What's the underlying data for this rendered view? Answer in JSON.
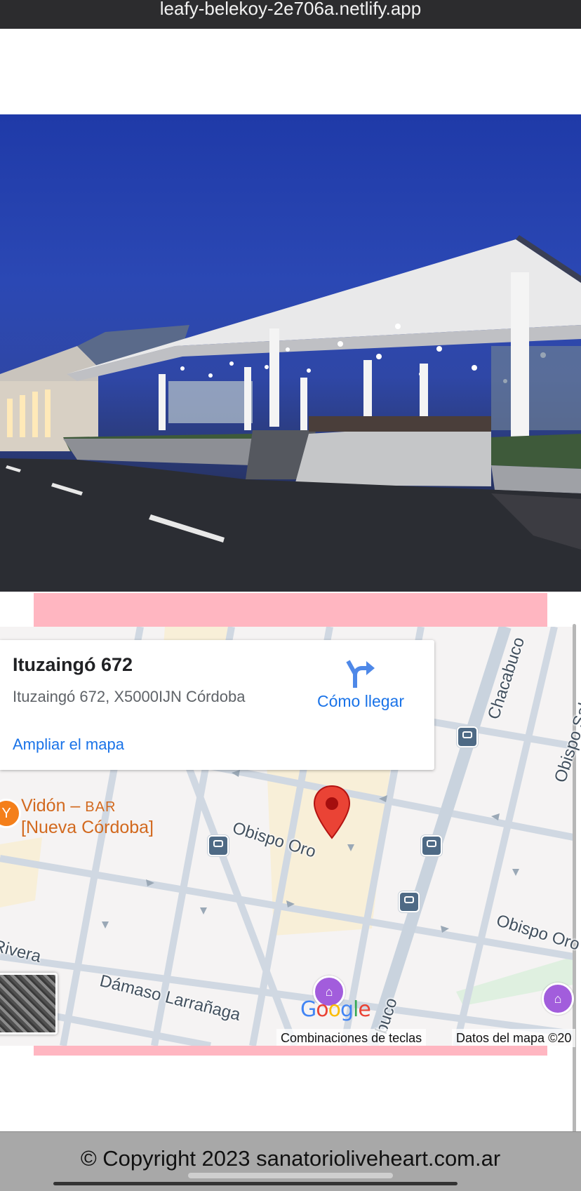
{
  "browser": {
    "url": "leafy-belekoy-2e706a.netlify.app"
  },
  "map": {
    "place_title": "Ituzaingó 672",
    "place_address": "Ituzaingó 672, X5000IJN Córdoba",
    "directions_label": "Cómo llegar",
    "expand_label": "Ampliar el mapa",
    "poi": {
      "name": "Vidón – ",
      "kind": "BAR",
      "area": "[Nueva Córdoba]"
    },
    "streets": [
      "Obispo Oro",
      "Chacabuco",
      "Obispo Sal",
      "Rivera",
      "Dámaso Larrañaga",
      "Obispo Oro",
      "buco"
    ],
    "keyboard_shortcuts": "Combinaciones de teclas",
    "map_data": "Datos del mapa ©20",
    "icons": [
      "directions-icon",
      "map-pin-icon",
      "bus-stop-icon",
      "museum-icon",
      "bar-icon"
    ]
  },
  "footer": {
    "copyright": "© Copyright 2023 sanatorioliveheart.com.ar"
  },
  "colors": {
    "accent_blue": "#1a73e8",
    "pink_band": "#ffb6c1",
    "footer_bg": "#a8a8a8",
    "poi_orange": "#d2691e"
  }
}
